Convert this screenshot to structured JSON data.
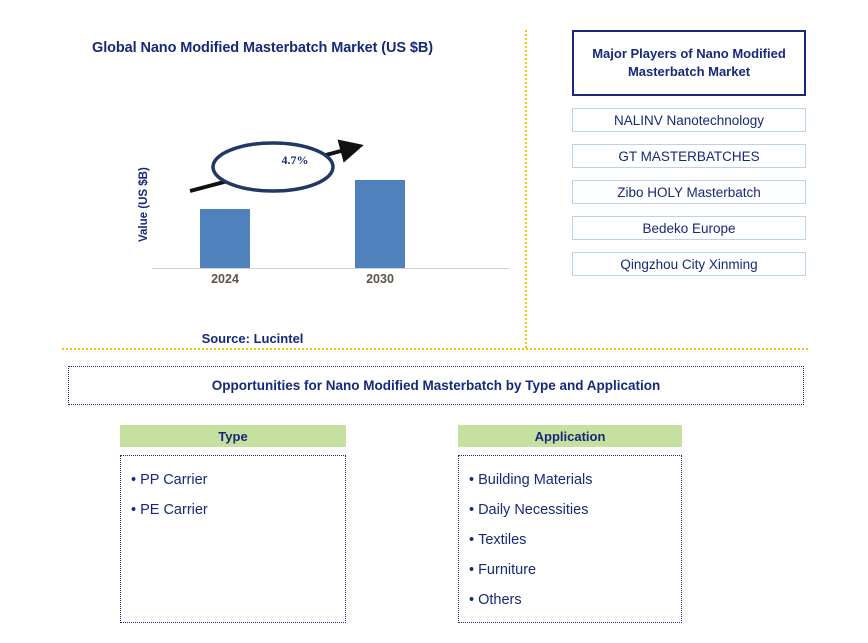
{
  "chart_panel": {
    "title": "Global Nano Modified Masterbatch Market (US $B)",
    "y_axis_label": "Value (US $B)",
    "cagr_label": "4.7%",
    "source": "Source: Lucintel"
  },
  "chart_data": {
    "type": "bar",
    "title": "Global Nano Modified Masterbatch Market (US $B)",
    "categories": [
      "2024",
      "2030"
    ],
    "values": [
      59,
      88
    ],
    "value_unit": "relative bar height (px, unlabeled axis)",
    "xlabel": "",
    "ylabel": "Value (US $B)",
    "grid": false,
    "legend": "none",
    "annotations": [
      {
        "text": "4.7%",
        "kind": "cagr-callout",
        "from": "2024",
        "to": "2030"
      }
    ],
    "series_color": "#4F81BD"
  },
  "players": {
    "header": "Major Players of Nano Modified Masterbatch Market",
    "items": [
      "NALINV Nanotechnology",
      "GT MASTERBATCHES",
      "Zibo HOLY Masterbatch",
      "Bedeko Europe",
      "Qingzhou City Xinming"
    ]
  },
  "opportunities": {
    "banner": "Opportunities for Nano Modified Masterbatch by Type and Application",
    "columns": [
      {
        "header": "Type",
        "items": [
          "PP Carrier",
          "PE Carrier"
        ]
      },
      {
        "header": "Application",
        "items": [
          "Building Materials",
          "Daily Necessities",
          "Textiles",
          "Furniture",
          "Others"
        ]
      }
    ]
  },
  "colors": {
    "navy": "#16297A",
    "bar_blue": "#4F81BD",
    "green_header": "#C6E0A0",
    "divider_orange": "#FFC000",
    "tick_gray": "#5C534B"
  },
  "bullet_glyph": "•"
}
